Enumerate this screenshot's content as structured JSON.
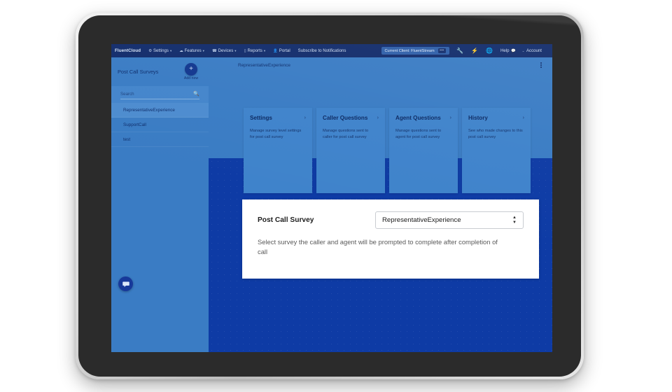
{
  "topnav": {
    "brand": "FluentCloud",
    "items": [
      {
        "label": "Settings",
        "icon": "gear-icon",
        "caret": "▾"
      },
      {
        "label": "Features",
        "icon": "cloud-icon",
        "caret": "▾"
      },
      {
        "label": "Devices",
        "icon": "phone-icon",
        "caret": "▾"
      },
      {
        "label": "Reports",
        "icon": "bar-chart-icon",
        "caret": "▾"
      },
      {
        "label": "Portal",
        "icon": "user-icon",
        "caret": ""
      },
      {
        "label": "Subscribe to Notifications",
        "icon": "",
        "caret": ""
      }
    ],
    "client_pill": {
      "label": "Current Client: FluentStream",
      "dots": "•••"
    },
    "right_icons": [
      {
        "name": "wrench-icon",
        "glyph": "⚒"
      },
      {
        "name": "bolt-icon",
        "glyph": "⚡"
      },
      {
        "name": "globe-icon",
        "glyph": "⊕"
      }
    ],
    "help": {
      "label": "Help",
      "icon": "chat-bubble-icon"
    },
    "account": {
      "label": "Account",
      "caret": "⌄"
    }
  },
  "sidebar": {
    "title": "Post Call Surveys",
    "add_new": {
      "label": "Add new",
      "icon": "plus-icon",
      "glyph": "+"
    },
    "search": {
      "placeholder": "Search",
      "value": "",
      "icon": "search-icon"
    },
    "items": [
      {
        "label": "RepresentativeExperience",
        "active": true
      },
      {
        "label": "SupportCall",
        "active": false
      },
      {
        "label": "test",
        "active": false
      }
    ],
    "chat_fab": {
      "icon": "chat-bubble-icon"
    }
  },
  "content": {
    "header_title": "RepresentativeExperience",
    "menu_icon": "kebab-menu-icon",
    "cards": [
      {
        "title": "Settings",
        "desc": "Manage survey level settings for post call survey",
        "chevron": "›"
      },
      {
        "title": "Caller Questions",
        "desc": "Manage questions sent to caller for post call survey",
        "chevron": "›"
      },
      {
        "title": "Agent Questions",
        "desc": "Manage questions sent to agent for post call survey",
        "chevron": "›"
      },
      {
        "title": "History",
        "desc": "See who made changes to this post call survey",
        "chevron": "›"
      }
    ],
    "panel": {
      "label": "Post Call Survey",
      "select_value": "RepresentativeExperience",
      "select_options": [
        "RepresentativeExperience",
        "SupportCall",
        "test"
      ],
      "description": "Select survey the caller and agent will be prompted to complete after completion of call"
    }
  },
  "colors": {
    "navbar": "#122c6b",
    "sidebar": "#3a7cc4",
    "main_dark": "#0e3ba5",
    "card": "#3f83cb",
    "accent_circle": "#12378f",
    "panel_bg": "#ffffff"
  }
}
